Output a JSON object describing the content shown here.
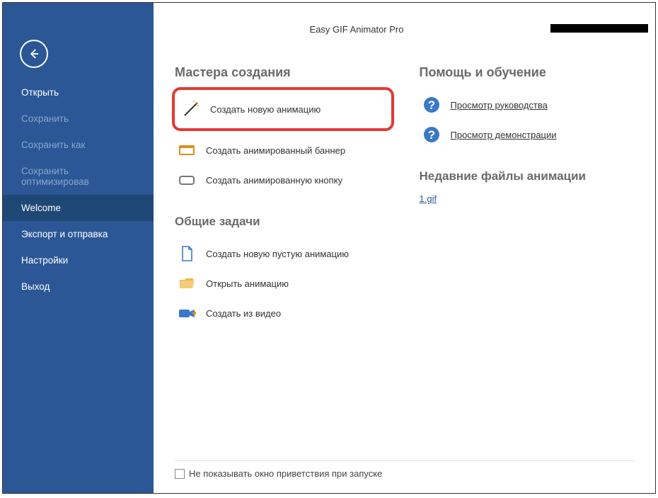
{
  "app_title": "Easy GIF Animator Pro",
  "sidebar": {
    "items": [
      {
        "label": "Открыть",
        "disabled": false
      },
      {
        "label": "Сохранить",
        "disabled": true
      },
      {
        "label": "Сохранить как",
        "disabled": true
      },
      {
        "label": "Сохранить оптимизировав",
        "disabled": true
      },
      {
        "label": "Welcome"
      },
      {
        "label": "Экспорт и отправка"
      },
      {
        "label": "Настройки"
      },
      {
        "label": "Выход"
      }
    ]
  },
  "sections": {
    "wizards_title": "Мастера создания",
    "help_title": "Помощь и обучение",
    "tasks_title": "Общие задачи",
    "recent_title": "Недавние файлы анимации",
    "wizards": {
      "new_anim": "Создать новую анимацию",
      "new_banner": "Создать анимированный баннер",
      "new_button": "Создать анимированную кнопку"
    },
    "help": {
      "guide": "Просмотр руководства",
      "demo": "Просмотр демонстрации"
    },
    "tasks": {
      "new_empty": "Создать новую пустую анимацию",
      "open_anim": "Открыть анимацию",
      "from_video": "Создать из видео"
    },
    "recent": {
      "file1": "1.gif"
    }
  },
  "footer": {
    "checkbox_label": "Не показывать окно приветствия при запуске"
  }
}
